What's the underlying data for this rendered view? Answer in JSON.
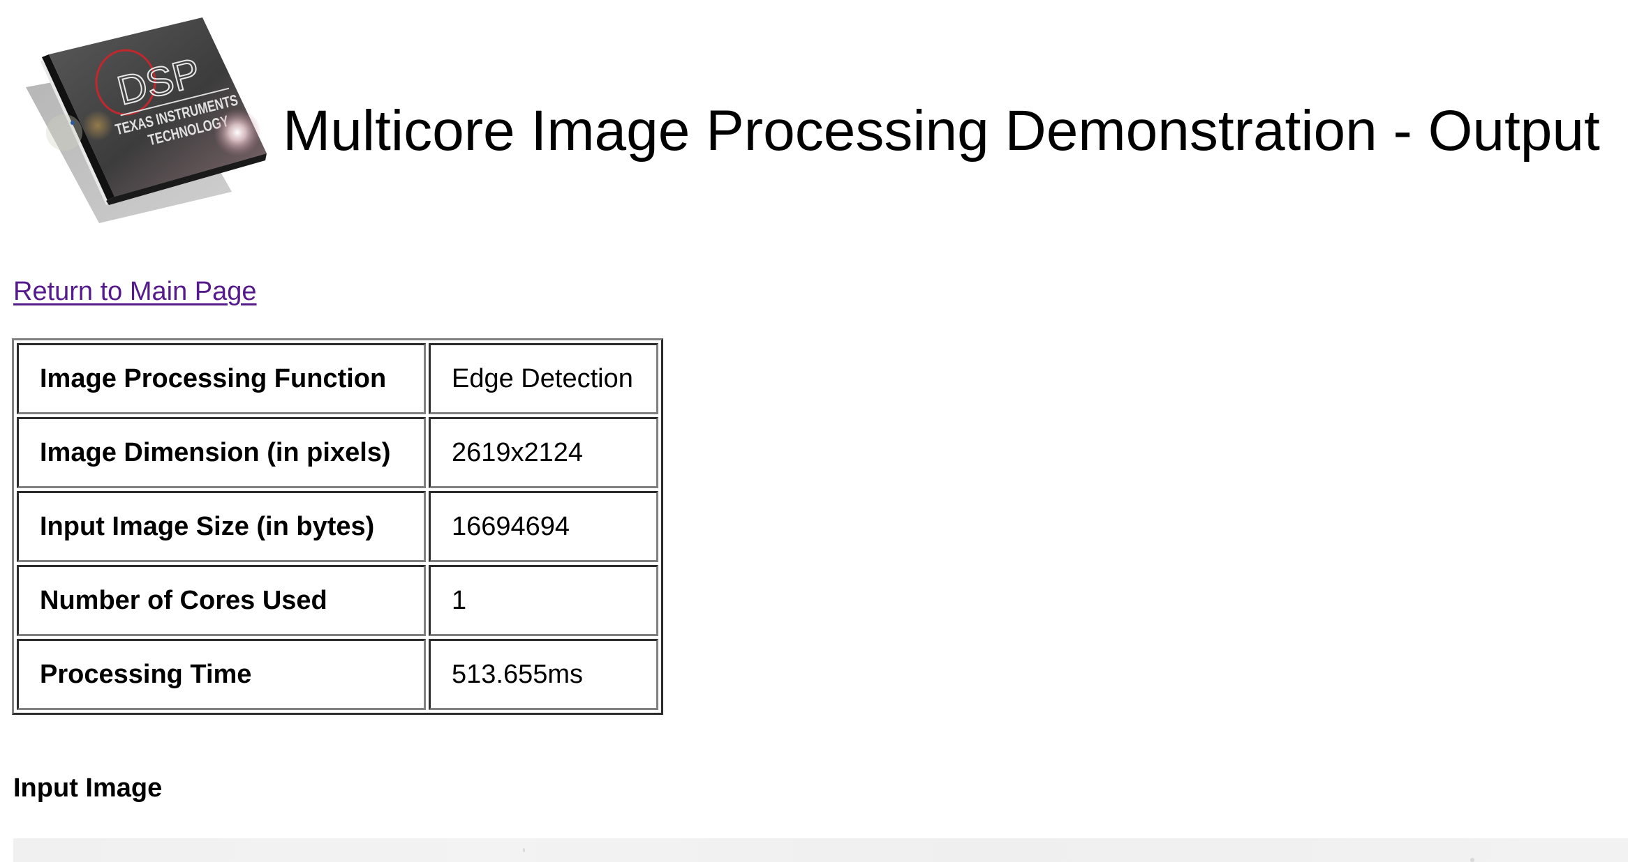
{
  "header": {
    "logo": {
      "icon": "dsp-chip-logo-icon",
      "text_main": "DSP",
      "text_line1": "TEXAS INSTRUMENTS",
      "text_line2": "TECHNOLOGY"
    },
    "title": "Multicore Image Processing Demonstration - Output"
  },
  "nav": {
    "return_link": "Return to Main Page"
  },
  "info_table": {
    "rows": [
      {
        "label": "Image Processing Function",
        "value": "Edge Detection"
      },
      {
        "label": "Image Dimension (in pixels)",
        "value": "2619x2124"
      },
      {
        "label": "Input Image Size (in bytes)",
        "value": "16694694"
      },
      {
        "label": "Number of Cores Used",
        "value": "1"
      },
      {
        "label": "Processing Time",
        "value": "513.655ms"
      }
    ]
  },
  "input_section": {
    "heading": "Input Image"
  },
  "colors": {
    "visited_link": "#551a8b",
    "text": "#000000",
    "background": "#ffffff"
  }
}
